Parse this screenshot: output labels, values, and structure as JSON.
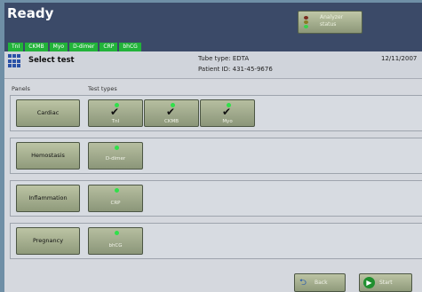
{
  "app": {
    "title": "Ready"
  },
  "status_button": {
    "line1": "Analyzer",
    "line2": "status"
  },
  "tabs": [
    {
      "label": "TnI"
    },
    {
      "label": "CKMB"
    },
    {
      "label": "Myo"
    },
    {
      "label": "D-dimer"
    },
    {
      "label": "CRP"
    },
    {
      "label": "bhCG"
    }
  ],
  "header": {
    "title": "Select test",
    "tube_type": "Tube type: EDTA",
    "patient_id": "Patient ID: 431-45-9676",
    "date": "12/11/2007"
  },
  "columns": {
    "panels": "Panels",
    "test_types": "Test types"
  },
  "rows": [
    {
      "panel": "Cardiac",
      "tests": [
        {
          "label": "TnI",
          "checked": true
        },
        {
          "label": "CKMB",
          "checked": true
        },
        {
          "label": "Myo",
          "checked": true
        }
      ]
    },
    {
      "panel": "Hemostasis",
      "tests": [
        {
          "label": "D-dimer",
          "checked": false
        }
      ]
    },
    {
      "panel": "Inflammation",
      "tests": [
        {
          "label": "CRP",
          "checked": false
        }
      ]
    },
    {
      "panel": "Pregnancy",
      "tests": [
        {
          "label": "bhCG",
          "checked": false
        }
      ]
    }
  ],
  "footer": {
    "back_label": "Back",
    "start_label": "Start"
  },
  "colors": {
    "accent_green": "#22b33a",
    "topbar": "#3b4a68",
    "indicator": "#30e04a"
  }
}
